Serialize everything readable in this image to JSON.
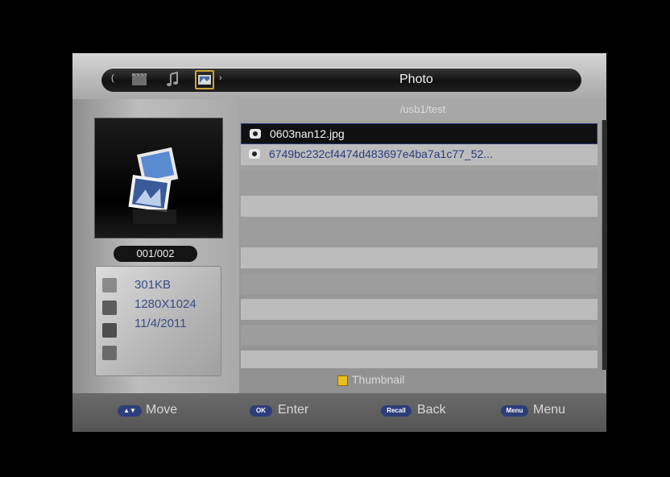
{
  "header": {
    "title": "Photo",
    "left_arrow": "(",
    "right_arrow": "›",
    "categories": [
      "video-icon",
      "music-icon",
      "photo-icon"
    ]
  },
  "path": "/usb1/test",
  "preview": {
    "counter": "001/002"
  },
  "info": {
    "size": "301KB",
    "resolution": "1280X1024",
    "date": "11/4/2011"
  },
  "files": [
    {
      "name": "0603nan12.jpg",
      "selected": true
    },
    {
      "name": "6749bc232cf4474d483697e4ba7a1c77_52...",
      "selected": false
    }
  ],
  "thumbnail_label": "Thumbnail",
  "footer": {
    "move_key": "▲▼",
    "move": "Move",
    "enter_key": "OK",
    "enter": "Enter",
    "back_key": "Recall",
    "back": "Back",
    "menu_key": "Menu",
    "menu": "Menu"
  },
  "colors": {
    "accent_blue": "#2c3c7c",
    "key_blue": "#2d3e7a",
    "yellow": "#e8c020"
  }
}
